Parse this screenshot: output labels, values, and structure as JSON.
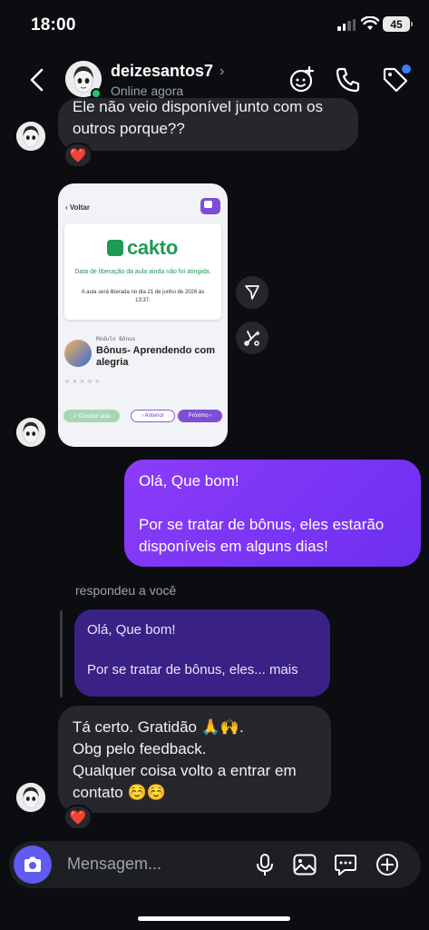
{
  "status_bar": {
    "time": "18:00",
    "battery": "45"
  },
  "header": {
    "name": "deizesantos7",
    "presence": "Online agora",
    "icons": [
      "back-arrow-icon",
      "sticker-icon",
      "phone-icon",
      "tag-icon"
    ]
  },
  "messages": {
    "m1": {
      "lines": [
        "Ele não veio disponível junto com os",
        "outros porque??"
      ],
      "reaction": "❤️"
    },
    "screenshot": {
      "back_label": "Voltar",
      "brand": "cakto",
      "notice": "Data de liberação da aula ainda não foi atingida.",
      "release_info": "A aula será liberada no dia 21 de junho de 2026 às 13:37.",
      "module_label": "Módulo Bônus",
      "lesson_title": "Bônus- Aprendendo com alegria",
      "stars": "★★★★★",
      "btn_done": "✓ Concluir aula",
      "btn_prev": "‹ Anterior",
      "btn_next": "Próximo ›"
    },
    "m2": {
      "line1": "Olá, Que bom!",
      "line2": "Por se tratar de bônus, eles estarão",
      "line3": "disponíveis em alguns dias!"
    },
    "reply": {
      "label": "respondeu a você",
      "quote_line1": "Olá, Que bom!",
      "quote_line2": "Por se tratar de bônus, eles... mais"
    },
    "m3": {
      "lines": [
        "Tá certo. Gratidão 🙏🙌.",
        "Obg pelo feedback.",
        "Qualquer coisa volto a entrar em",
        "contato ☺️☺️"
      ],
      "reaction": "❤️"
    }
  },
  "composer": {
    "placeholder": "Mensagem...",
    "icons": [
      "camera-icon",
      "microphone-icon",
      "gallery-icon",
      "sticker-chat-icon",
      "plus-icon"
    ]
  },
  "colors": {
    "accent": "#7b2ff7",
    "background": "#0b0d10",
    "incoming_bubble": "#25272c",
    "online": "#29c36a",
    "camera": "#5f5bf3"
  }
}
